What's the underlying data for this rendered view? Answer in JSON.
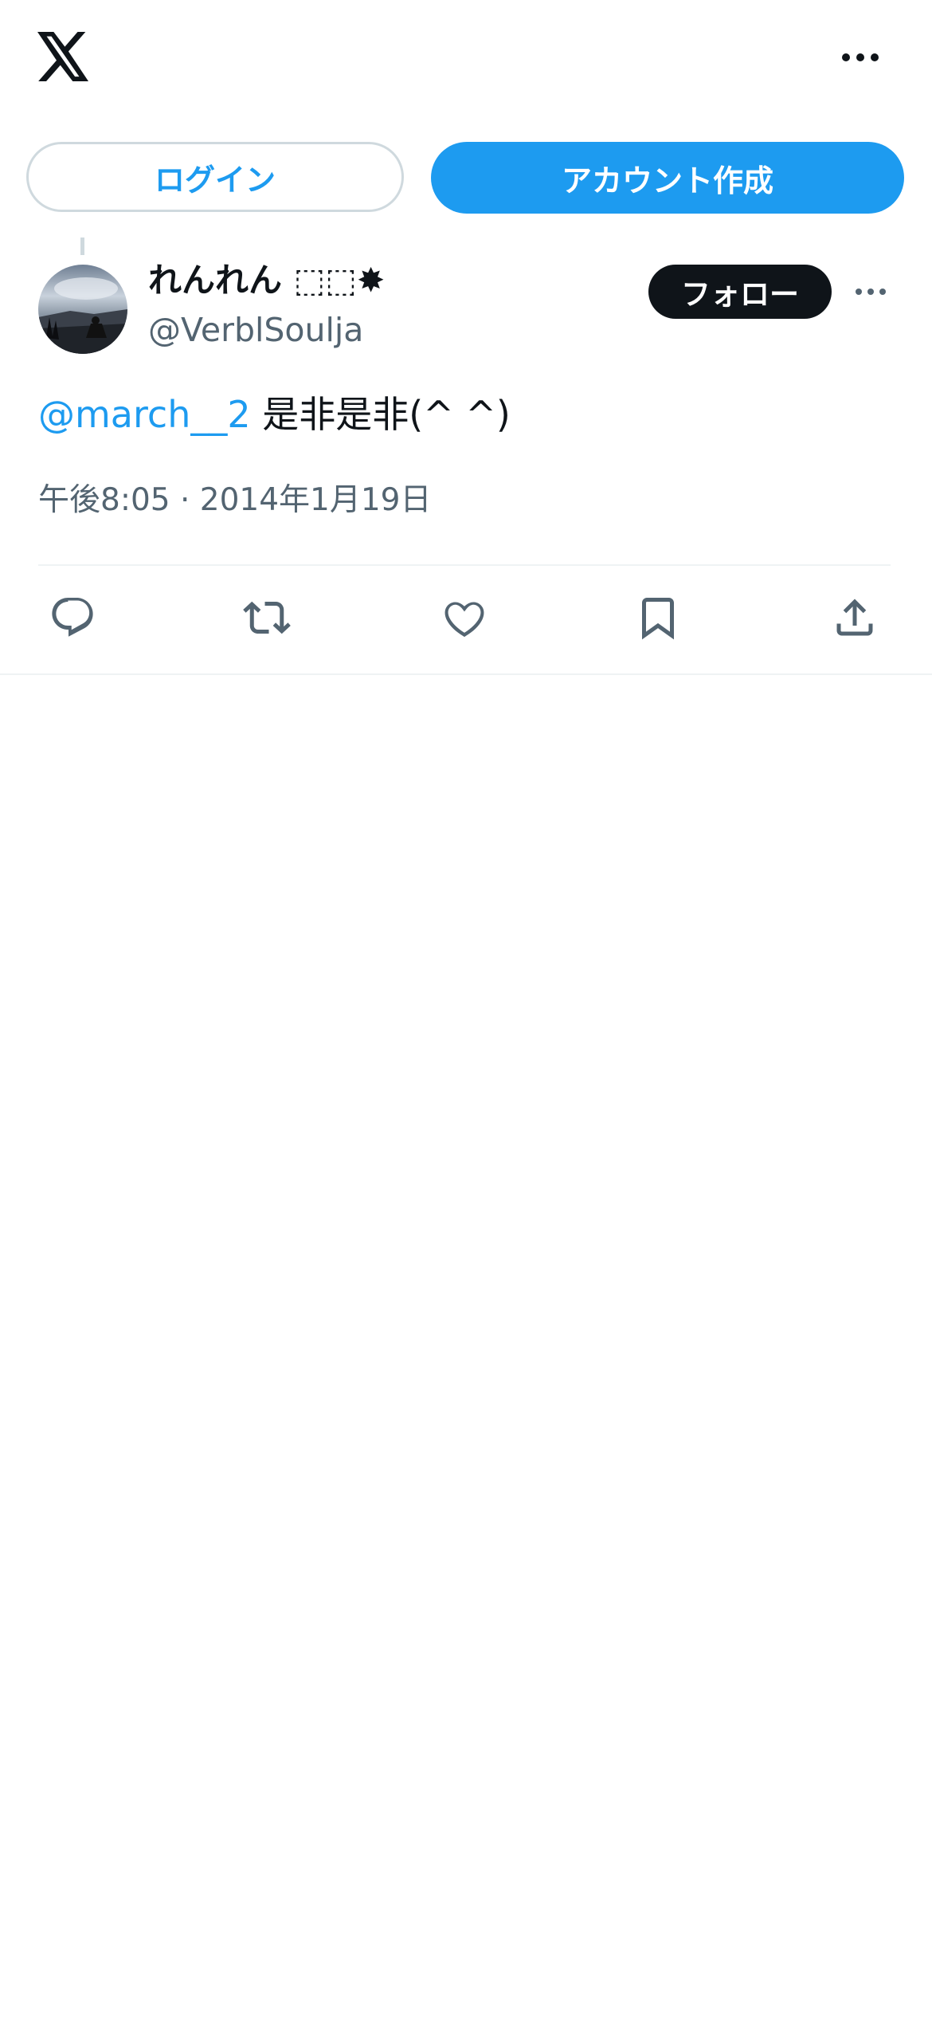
{
  "header": {
    "logo_icon": "x-logo-icon",
    "more_icon": "more-horizontal-icon"
  },
  "auth": {
    "login_label": "ログイン",
    "signup_label": "アカウント作成"
  },
  "tweet": {
    "display_name": "れんれん ⬚⬚✸",
    "handle": "@VerblSoulja",
    "follow_label": "フォロー",
    "mention": "@march__2",
    "text": " 是非是非(^ ^)",
    "timestamp": "午後8:05 · 2014年1月19日"
  },
  "actions": {
    "reply_icon": "reply-icon",
    "retweet_icon": "retweet-icon",
    "like_icon": "like-heart-icon",
    "bookmark_icon": "bookmark-icon",
    "share_icon": "share-icon"
  },
  "colors": {
    "accent": "#1d9bf0",
    "text": "#0f1419",
    "secondary": "#536471",
    "border": "#cfd9de"
  }
}
